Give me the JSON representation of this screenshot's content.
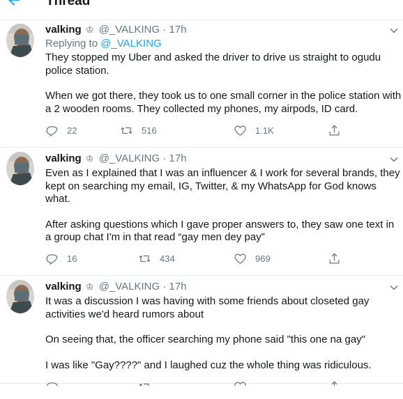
{
  "header": {
    "title": "Thread"
  },
  "tweets": [
    {
      "name": "valking",
      "handle": "@_VALKING",
      "time": "· 17h",
      "replying_prefix": "Replying to",
      "replying_to": "@_VALKING",
      "paragraphs": [
        "They stopped my Uber and asked the driver to drive us straight to ogudu police station.",
        "When we got there, they took us to one small corner in the police station with a 2 wooden rooms. They collected my phones, my airpods, ID card."
      ],
      "replies": "22",
      "retweets": "516",
      "likes": "1.1K"
    },
    {
      "name": "valking",
      "handle": "@_VALKING",
      "time": "· 17h",
      "paragraphs": [
        "Even as I explained that I was an influencer & I work for several brands, they kept on searching my email, IG, Twitter, & my WhatsApp for God knows what.",
        "After asking questions which I gave proper answers to, they saw one text in a group chat I'm in that read “gay men dey pay”"
      ],
      "replies": "16",
      "retweets": "434",
      "likes": "969"
    },
    {
      "name": "valking",
      "handle": "@_VALKING",
      "time": "· 17h",
      "paragraphs": [
        "It was a discussion I was having with some friends about closeted gay activities we'd heard rumors about",
        "On seeing that, the officer searching my phone said \"this one na gay\"",
        "I was like \"Gay????\" and I laughed cuz the whole thing was ridiculous."
      ]
    }
  ],
  "icons": {
    "back": "back-arrow-icon",
    "verified_symbol": "crown-icon",
    "more": "chevron-down-icon",
    "reply": "reply-icon",
    "retweet": "retweet-icon",
    "like": "heart-icon",
    "share": "share-icon"
  },
  "colors": {
    "accent": "#1da1f2",
    "text": "#14171a",
    "secondary": "#657786",
    "divider": "#e6ecf0"
  }
}
